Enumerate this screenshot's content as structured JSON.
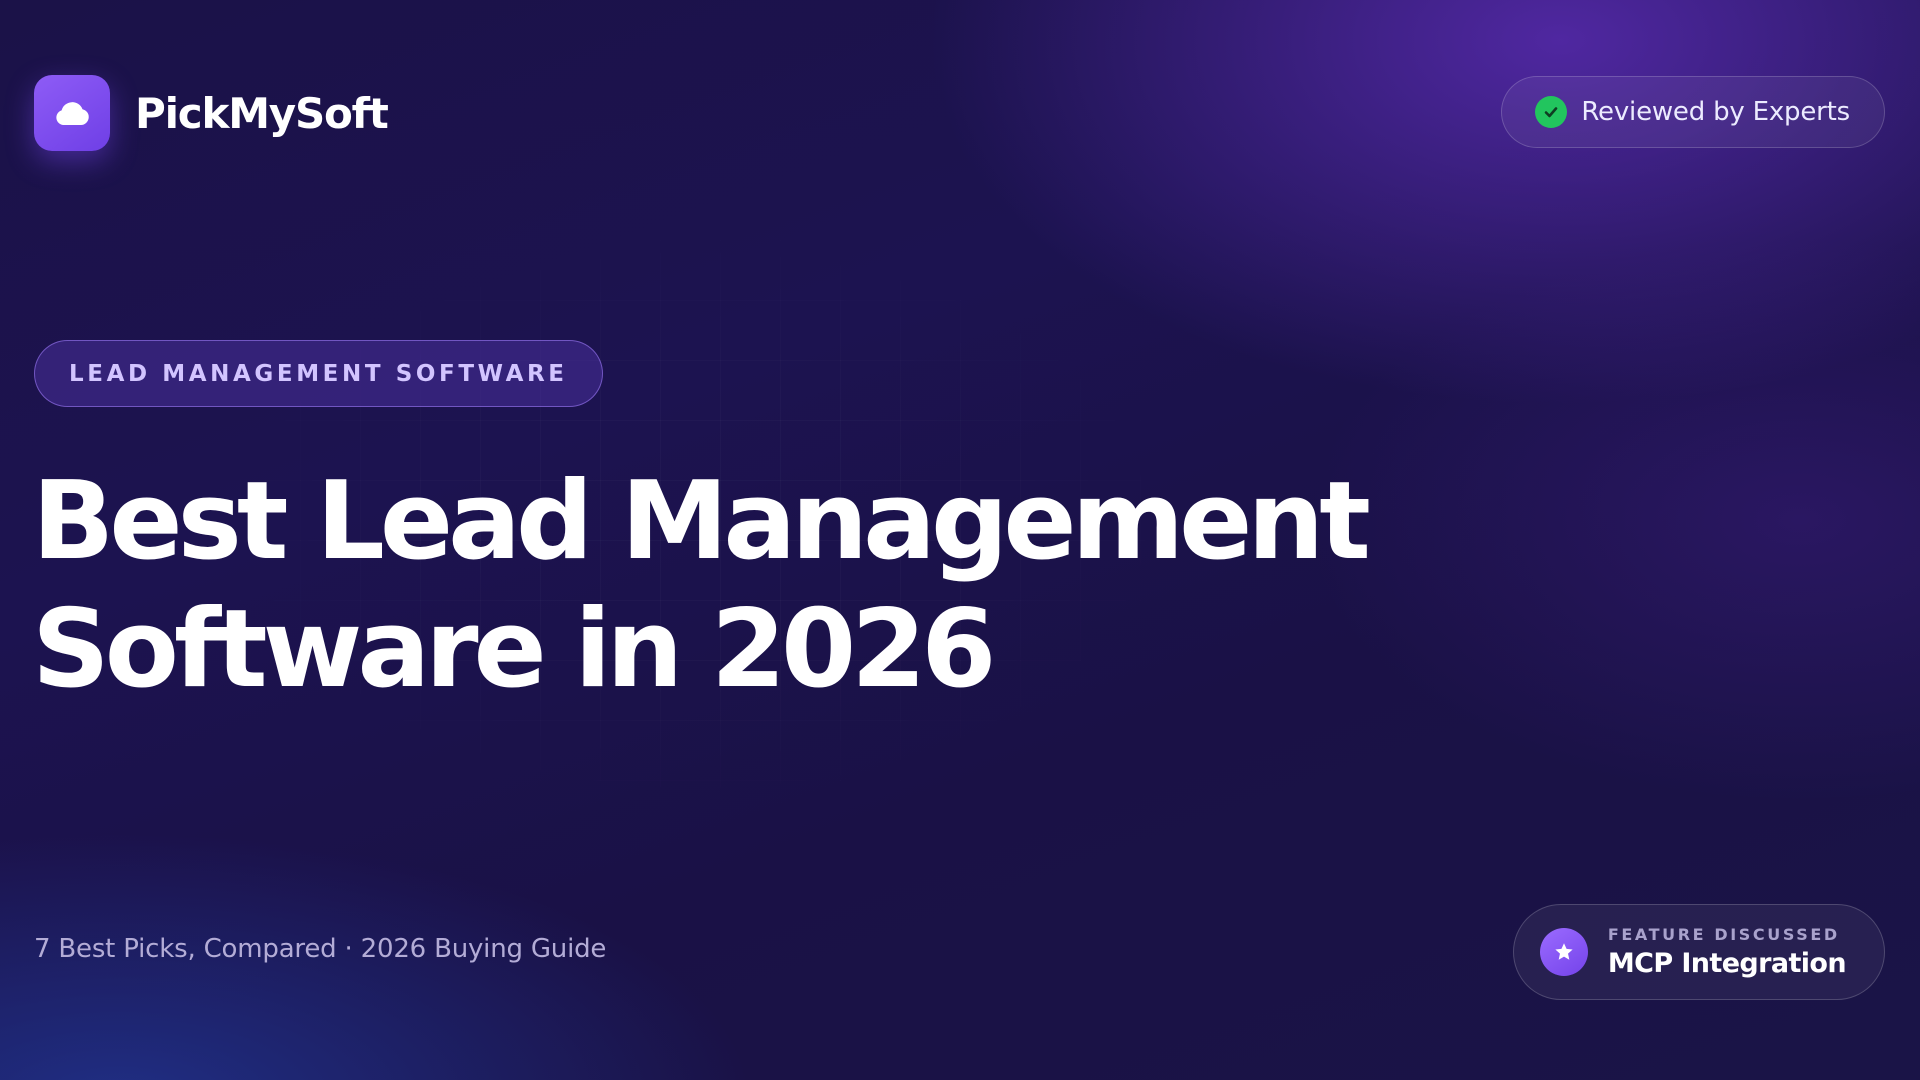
{
  "brand": {
    "name": "PickMySoft",
    "logo_icon": "cloud-icon",
    "accent_color": "#7c4dff"
  },
  "badge": {
    "label": "Reviewed by Experts",
    "icon": "check-icon",
    "icon_color": "#22c55e"
  },
  "category": {
    "label": "LEAD MANAGEMENT SOFTWARE"
  },
  "headline": {
    "line1": "Best Lead Management",
    "line2": "Software in 2026"
  },
  "subline": "7 Best Picks, Compared · 2026 Buying Guide",
  "feature": {
    "kicker": "FEATURE DISCUSSED",
    "value": "MCP Integration",
    "icon": "star-icon"
  }
}
